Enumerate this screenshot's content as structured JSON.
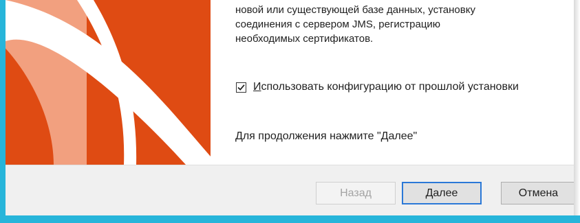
{
  "description": "новой или существующей базе данных, установку\nсоединения с сервером JMS, регистрацию\nнеобходимых сертификатов.",
  "checkbox": {
    "checked": true,
    "mnemonic": "И",
    "label_rest": "спользовать конфигурацию от прошлой установки"
  },
  "continue_text": "Для продолжения нажмите \"Далее\"",
  "buttons": {
    "back": "Назад",
    "next": "Далее",
    "cancel": "Отмена"
  },
  "colors": {
    "banner": "#df4b13",
    "window_border": "#27b5da",
    "focus": "#2a78d7"
  }
}
